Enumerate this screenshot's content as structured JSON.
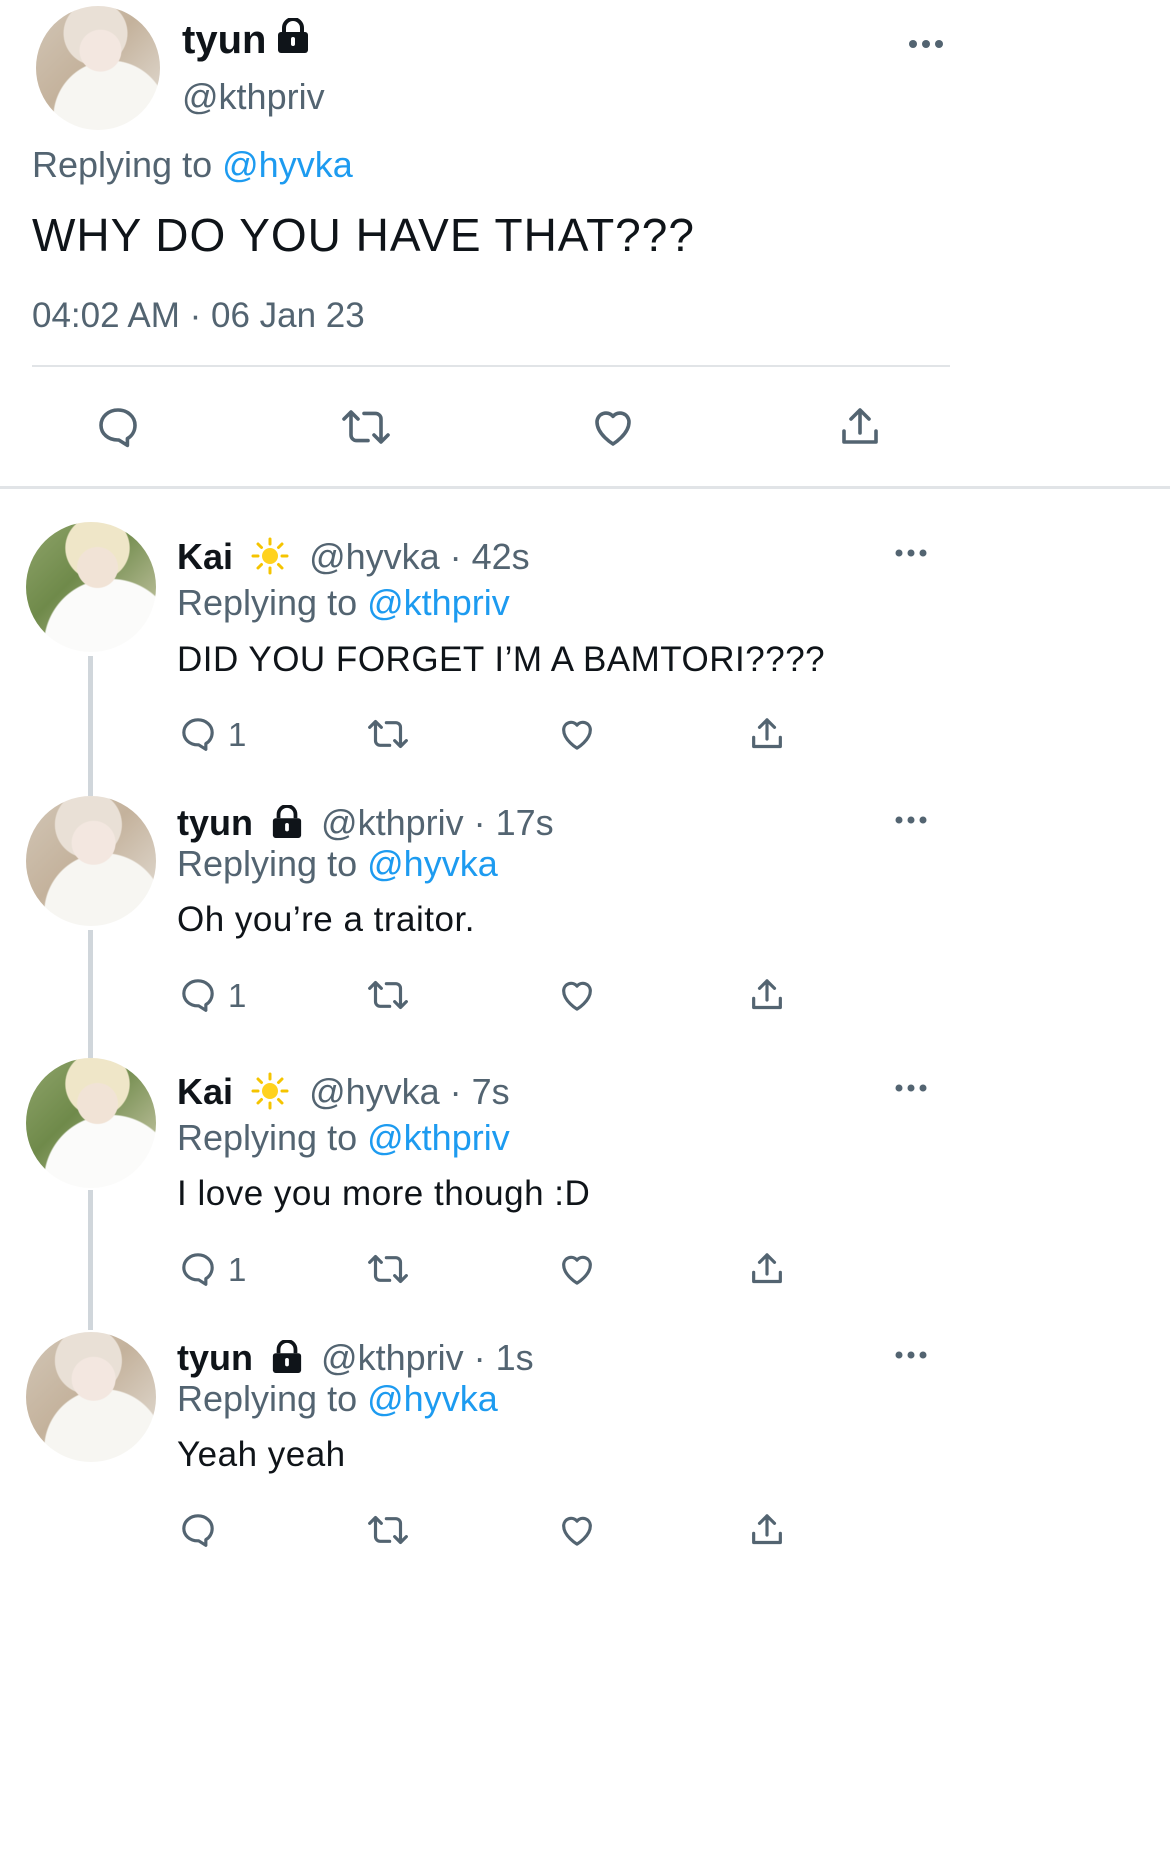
{
  "main_tweet": {
    "display_name": "tyun",
    "handle": "@kthpriv",
    "replying_prefix": "Replying to",
    "replying_to": "@hyvka",
    "text": "WHY DO YOU HAVE THAT???",
    "timestamp": "04:02 AM · 06 Jan 23"
  },
  "replies": [
    {
      "name": "Kai",
      "badge": "sun-icon",
      "meta": "@hyvka · 42s",
      "replying_prefix": "Replying to",
      "replying_to": "@kthpriv",
      "text": "DID YOU FORGET I’M A BAMTORI????",
      "reply_count": "1"
    },
    {
      "name": "tyun",
      "badge": "lock-icon",
      "meta": "@kthpriv · 17s",
      "replying_prefix": "Replying to",
      "replying_to": "@hyvka",
      "text": "Oh you’re a traitor.",
      "reply_count": "1"
    },
    {
      "name": "Kai",
      "badge": "sun-icon",
      "meta": "@hyvka · 7s",
      "replying_prefix": "Replying to",
      "replying_to": "@kthpriv",
      "text": "I love you more though :D",
      "reply_count": "1"
    },
    {
      "name": "tyun",
      "badge": "lock-icon",
      "meta": "@kthpriv · 1s",
      "replying_prefix": "Replying to",
      "replying_to": "@hyvka",
      "text": "Yeah yeah",
      "reply_count": ""
    }
  ],
  "colors": {
    "link": "#1d9bf0",
    "secondary": "#536471",
    "divider": "#e1e4e7"
  }
}
